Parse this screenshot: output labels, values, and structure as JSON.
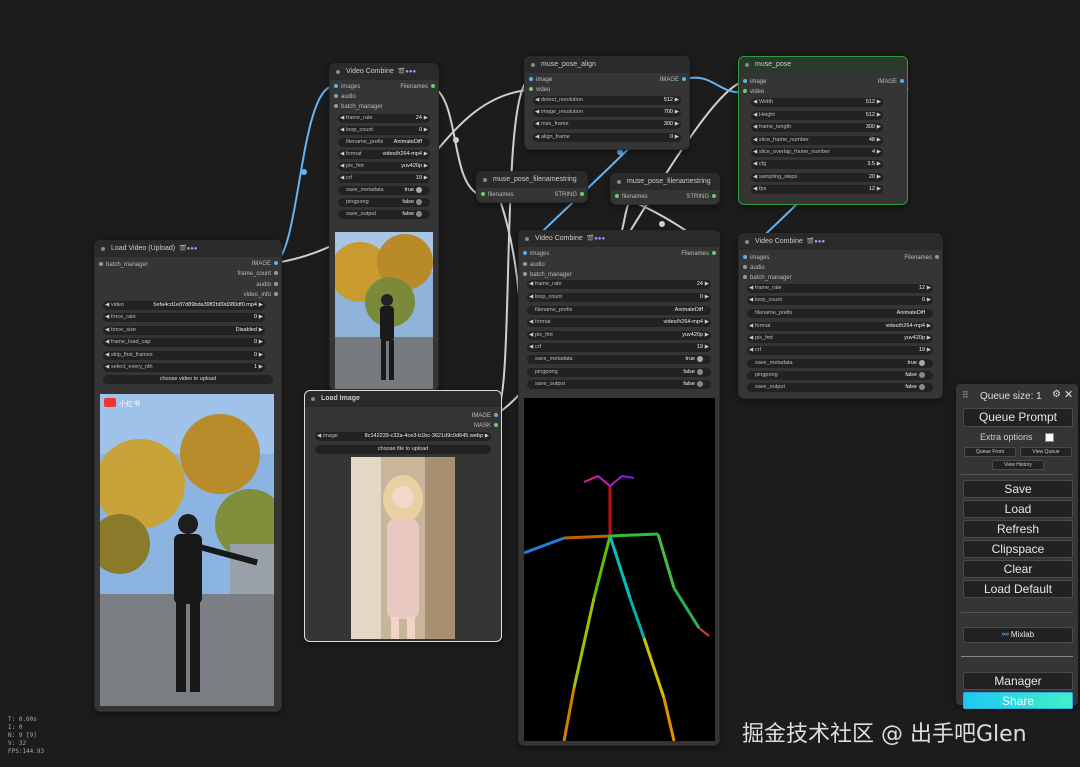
{
  "colors": {
    "canvas": "#1c1c1c",
    "node": "#353535",
    "title": "#2a2a2a",
    "widget": "#222222",
    "link_image": "#64b5f6",
    "link_string": "#cfcfcf",
    "share": "#2ee0e0",
    "selected_green": "#2f9a3a"
  },
  "nodes": {
    "vc1": {
      "title": "Video Combine",
      "badge": "🎬●●●",
      "in": [
        "images",
        "audio",
        "batch_manager"
      ],
      "out": [
        "Filenames"
      ],
      "w": [
        [
          "frame_rate",
          "24"
        ],
        [
          "loop_count",
          "0"
        ],
        [
          "filename_prefix",
          "AnimateDiff"
        ],
        [
          "format",
          "video/h264-mp4"
        ],
        [
          "pix_fmt",
          "yuv420p"
        ],
        [
          "crf",
          "19"
        ],
        [
          "save_metadata",
          "true"
        ],
        [
          "pingpong",
          "false"
        ],
        [
          "save_output",
          "false"
        ]
      ]
    },
    "align": {
      "title": "muse_pose_align",
      "in": [
        "image",
        "video"
      ],
      "out": [
        "IMAGE"
      ],
      "w": [
        [
          "detect_resolution",
          "512"
        ],
        [
          "image_resolution",
          "700"
        ],
        [
          "max_frame",
          "300"
        ],
        [
          "align_frame",
          "0"
        ]
      ]
    },
    "pose": {
      "title": "muse_pose",
      "in": [
        "image",
        "video"
      ],
      "out": [
        "IMAGE"
      ],
      "w": [
        [
          "Width",
          "512"
        ],
        [
          "Height",
          "512"
        ],
        [
          "frame_length",
          "300"
        ],
        [
          "slice_frame_number",
          "48"
        ],
        [
          "slice_overlap_frame_number",
          "4"
        ],
        [
          "cfg",
          "3.5"
        ],
        [
          "sampling_steps",
          "20"
        ],
        [
          "fps",
          "12"
        ]
      ]
    },
    "fn1": {
      "title": "muse_pose_filenamestring",
      "in": [
        "filenames"
      ],
      "out": [
        "STRING"
      ]
    },
    "fn2": {
      "title": "muse_pose_filenamestring",
      "in": [
        "filenames"
      ],
      "out": [
        "STRING"
      ]
    },
    "load": {
      "title": "Load Video (Upload)",
      "badge": "🎬●●●",
      "in": [
        "batch_manager"
      ],
      "out": [
        "IMAGE",
        "frame_count",
        "audio",
        "video_info"
      ],
      "w": [
        [
          "video",
          "5efa4cd1e87d89bda39ff2b89d380df0.mp4"
        ],
        [
          "force_rate",
          "0"
        ],
        [
          "force_size",
          "Disabled"
        ],
        [
          "frame_load_cap",
          "0"
        ],
        [
          "skip_first_frames",
          "0"
        ],
        [
          "select_every_nth",
          "1"
        ]
      ],
      "button": "choose video to upload"
    },
    "limg": {
      "title": "Load Image",
      "out": [
        "IMAGE",
        "MASK"
      ],
      "w": [
        [
          "image",
          "8c142239-c32a-4ce3-b1bc-3621d9c0d645.webp"
        ]
      ],
      "button": "choose file to upload"
    },
    "vc2": {
      "title": "Video Combine",
      "badge": "🎬●●●",
      "in": [
        "images",
        "audio",
        "batch_manager"
      ],
      "out": [
        "Filenames"
      ],
      "w": [
        [
          "frame_rate",
          "24"
        ],
        [
          "loop_count",
          "0"
        ],
        [
          "filename_prefix",
          "AnimateDiff"
        ],
        [
          "format",
          "video/h264-mp4"
        ],
        [
          "pix_fmt",
          "yuv420p"
        ],
        [
          "crf",
          "19"
        ],
        [
          "save_metadata",
          "true"
        ],
        [
          "pingpong",
          "false"
        ],
        [
          "save_output",
          "false"
        ]
      ]
    },
    "vc3": {
      "title": "Video Combine",
      "badge": "🎬●●●",
      "in": [
        "images",
        "audio",
        "batch_manager"
      ],
      "out": [
        "Filenames"
      ],
      "w": [
        [
          "frame_rate",
          "12"
        ],
        [
          "loop_count",
          "0"
        ],
        [
          "filename_prefix",
          "AnimateDiff"
        ],
        [
          "format",
          "video/h264-mp4"
        ],
        [
          "pix_fmt",
          "yuv420p"
        ],
        [
          "crf",
          "19"
        ],
        [
          "save_metadata",
          "true"
        ],
        [
          "pingpong",
          "false"
        ],
        [
          "save_output",
          "false"
        ]
      ]
    }
  },
  "menu": {
    "queue_size": "Queue size: 1",
    "queue_prompt": "Queue Prompt",
    "extra_options": "Extra options",
    "queue_front": "Queue Front",
    "view_queue": "View Queue",
    "view_history": "View History",
    "save": "Save",
    "load": "Load",
    "refresh": "Refresh",
    "clipspace": "Clipspace",
    "clear": "Clear",
    "load_default": "Load Default",
    "mixlab": "Mixlab",
    "manager": "Manager",
    "share": "Share"
  },
  "stats": [
    "T: 0.00s",
    "I: 0",
    "N: 9 [9]",
    "V: 32",
    "FPS:144.93"
  ],
  "watermark": "掘金技术社区 @ 出手吧Glen",
  "preview_logo": "小红书"
}
